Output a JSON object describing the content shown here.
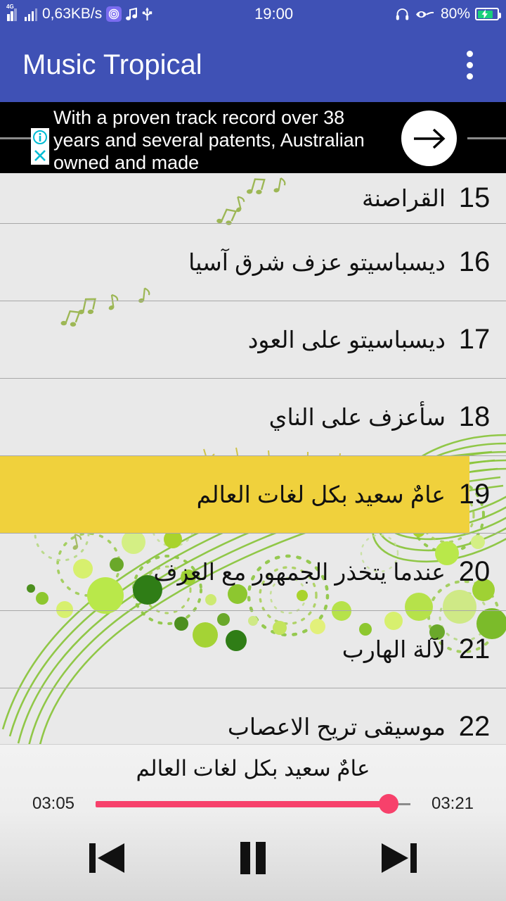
{
  "status_bar": {
    "network_type": "4G",
    "net_speed": "0,63KB/s",
    "clock": "19:00",
    "battery_percent": "80%",
    "icons": [
      "signal-icon",
      "signal-secondary-icon",
      "fingerprint-icon",
      "music-note-icon",
      "usb-icon",
      "headset-icon",
      "eye-care-icon",
      "battery-charging-icon"
    ],
    "accent": "#3f51b5"
  },
  "app_bar": {
    "title": "Music Tropical",
    "overflow_label": "More options",
    "background": "#3f51b5"
  },
  "ad": {
    "text": "With a proven track record over 38 years and several patents, Australian owned and made",
    "info_badge": "i",
    "close_badge": "×",
    "cta_label": "arrow-right",
    "background": "#000000",
    "badge_color": "#00bcd4"
  },
  "list": {
    "highlight_color": "#f0d13c",
    "items": [
      {
        "num": "15",
        "title": "القراصنة",
        "selected": false,
        "partial": true
      },
      {
        "num": "16",
        "title": "ديسباسيتو عزف شرق آسيا",
        "selected": false,
        "partial": false
      },
      {
        "num": "17",
        "title": "ديسباسيتو على العود",
        "selected": false,
        "partial": false
      },
      {
        "num": "18",
        "title": "سأعزف على الناي",
        "selected": false,
        "partial": false
      },
      {
        "num": "19",
        "title": "عامٌ سعيد بكل لغات العالم",
        "selected": true,
        "partial": false
      },
      {
        "num": "20",
        "title": "عندما يتخذر الجمهور مع العزف",
        "selected": false,
        "partial": false
      },
      {
        "num": "21",
        "title": "لآلة الهارب",
        "selected": false,
        "partial": false
      },
      {
        "num": "22",
        "title": "موسيقى تريح الاعصاب",
        "selected": false,
        "partial": false
      }
    ]
  },
  "player": {
    "now_playing": "عامٌ سعيد بكل لغات العالم",
    "elapsed": "03:05",
    "total": "03:21",
    "progress_percent": 93,
    "seek_color": "#f7416b",
    "prev_label": "previous-track",
    "play_pause_label": "pause",
    "next_label": "next-track",
    "state": "playing"
  }
}
